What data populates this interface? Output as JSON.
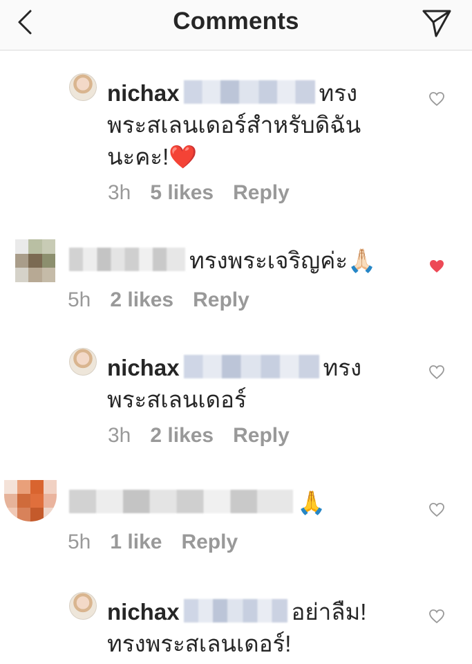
{
  "header": {
    "title": "Comments",
    "back_icon": "chevron-left-icon",
    "send_icon": "paper-plane-icon"
  },
  "comments": [
    {
      "username": "nichax",
      "text": "ทรง",
      "text2": "พระสเลนเดอร์สำหรับดิฉัน",
      "text3": "นะคะ!❤️",
      "time": "3h",
      "likes": "5 likes",
      "reply": "Reply",
      "liked": false
    },
    {
      "username": "",
      "text": "ทรงพระเจริญค่ะ🙏🏻",
      "time": "5h",
      "likes": "2 likes",
      "reply": "Reply",
      "liked": true
    },
    {
      "username": "nichax",
      "text": "ทรง",
      "text2": "พระสเลนเดอร์",
      "time": "3h",
      "likes": "2 likes",
      "reply": "Reply",
      "liked": false
    },
    {
      "username": "",
      "text": "🙏",
      "time": "5h",
      "likes": "1 like",
      "reply": "Reply",
      "liked": false
    },
    {
      "username": "nichax",
      "text": "อย่าลืม!",
      "text2": "ทรงพระสเลนเดอร์!",
      "liked": false
    }
  ],
  "colors": {
    "liked_heart": "#ed4956",
    "meta": "#999999",
    "text": "#262626"
  }
}
